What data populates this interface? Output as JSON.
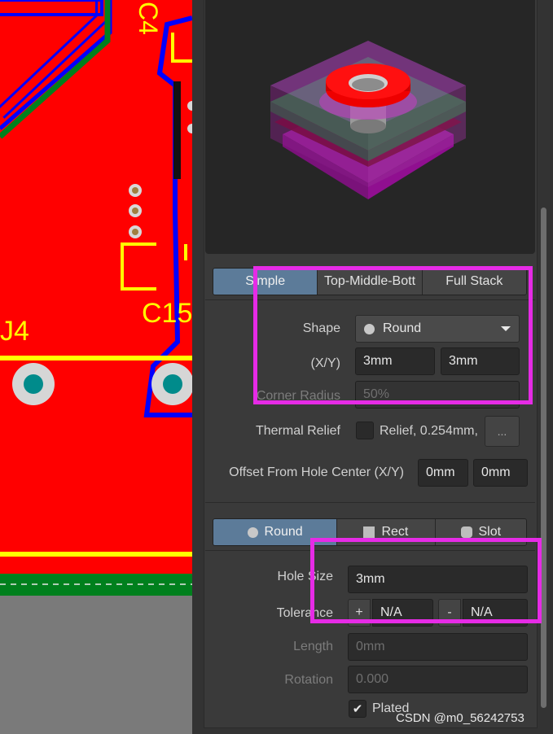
{
  "pcb": {
    "labels": {
      "c4": "C4",
      "j4": "J4",
      "c15": "C15"
    }
  },
  "pad_stack_tabs": [
    {
      "label": "Simple",
      "active": true
    },
    {
      "label": "Top-Middle-Bott",
      "active": false
    },
    {
      "label": "Full Stack",
      "active": false
    }
  ],
  "pad": {
    "shape_label": "Shape",
    "shape_value": "Round",
    "size_label": "(X/Y)",
    "size_x": "3mm",
    "size_y": "3mm",
    "corner_radius_label": "Corner Radius",
    "corner_radius_value": "50%",
    "thermal_relief_label": "Thermal Relief",
    "thermal_relief_value": "Relief, 0.254mm,",
    "thermal_relief_button": "...",
    "offset_label": "Offset From Hole Center (X/Y)",
    "offset_x": "0mm",
    "offset_y": "0mm"
  },
  "hole_tabs": [
    {
      "label": "Round",
      "active": true,
      "icon": "circle-icon"
    },
    {
      "label": "Rect",
      "active": false,
      "icon": "square-icon"
    },
    {
      "label": "Slot",
      "active": false,
      "icon": "rounded-square-icon"
    }
  ],
  "hole": {
    "size_label": "Hole Size",
    "size_value": "3mm",
    "tolerance_label": "Tolerance",
    "tolerance_plus_sign": "+",
    "tolerance_plus_value": "N/A",
    "tolerance_minus_sign": "-",
    "tolerance_minus_value": "N/A",
    "length_label": "Length",
    "length_value": "0mm",
    "rotation_label": "Rotation",
    "rotation_value": "0.000",
    "plated_label": "Plated",
    "plated_checked": true
  },
  "watermark": "CSDN @m0_56242753",
  "colors": {
    "copper_top": "#ff0000",
    "silkscreen": "#ffff00",
    "outline": "#0000ff",
    "annotation": "#e62be6",
    "tab_active": "#5c7b99"
  }
}
